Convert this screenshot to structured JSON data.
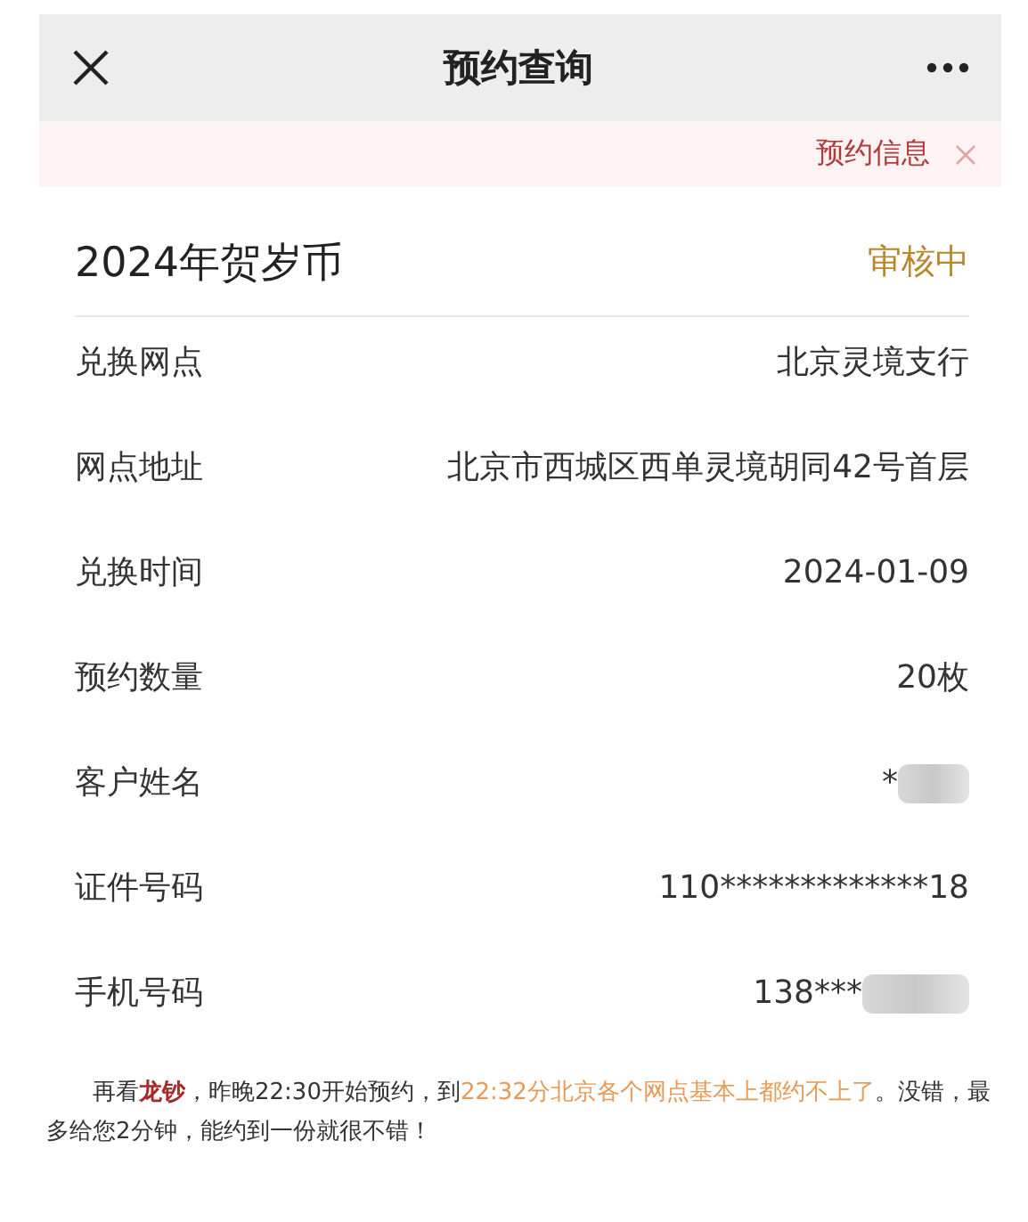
{
  "header": {
    "title": "预约查询"
  },
  "notice": {
    "text": "预约信息"
  },
  "card": {
    "title": "2024年贺岁币",
    "status": "审核中",
    "rows": [
      {
        "label": "兑换网点",
        "value": "北京灵境支行",
        "redacted": false
      },
      {
        "label": "网点地址",
        "value": "北京市西城区西单灵境胡同42号首层",
        "redacted": false
      },
      {
        "label": "兑换时间",
        "value": "2024-01-09",
        "redacted": false
      },
      {
        "label": "预约数量",
        "value": "20枚",
        "redacted": false
      },
      {
        "label": "客户姓名",
        "value": "*",
        "redacted": true
      },
      {
        "label": "证件号码",
        "value": "110*************18",
        "redacted": false
      },
      {
        "label": "手机号码",
        "value": "138***",
        "redacted": true
      }
    ]
  },
  "caption": {
    "segments": [
      {
        "kind": "plain",
        "text": "再看"
      },
      {
        "kind": "strong",
        "text": "龙钞"
      },
      {
        "kind": "plain",
        "text": "，昨晚22:30开始预约，到"
      },
      {
        "kind": "highlight",
        "text": "22:32分北京各个网点基本上都约不上了"
      },
      {
        "kind": "plain",
        "text": "。没错，最多给您2分钟，能约到一份就很不错！"
      }
    ]
  }
}
